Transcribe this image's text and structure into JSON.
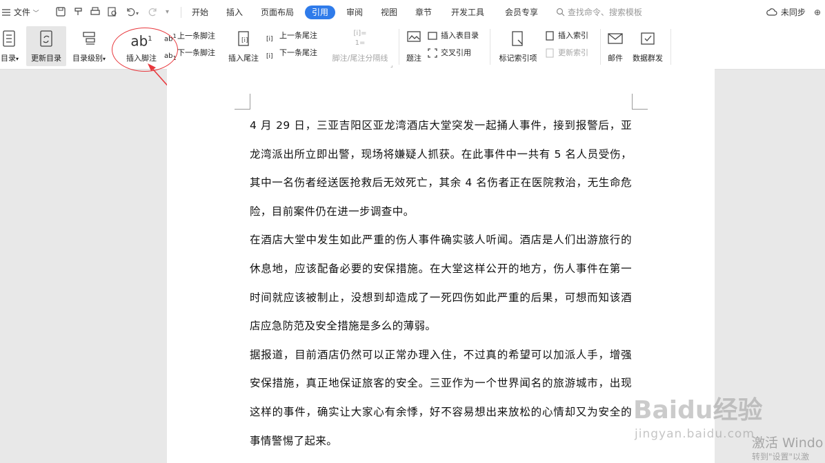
{
  "topbar": {
    "menu_label": "文件",
    "tabs": [
      {
        "label": "开始"
      },
      {
        "label": "插入"
      },
      {
        "label": "页面布局"
      },
      {
        "label": "引用"
      },
      {
        "label": "审阅"
      },
      {
        "label": "视图"
      },
      {
        "label": "章节"
      },
      {
        "label": "开发工具"
      },
      {
        "label": "会员专享"
      }
    ],
    "active_tab": "引用",
    "search_placeholder": "查找命令、搜索模板",
    "sync_label": "未同步"
  },
  "ribbon": {
    "toc": "目录",
    "update_toc": "更新目录",
    "toc_level": "目录级别",
    "insert_footnote": "插入脚注",
    "prev_footnote": "上一条脚注",
    "next_footnote": "下一条脚注",
    "insert_endnote": "插入尾注",
    "prev_endnote": "上一条尾注",
    "next_endnote": "下一条尾注",
    "separator": "脚注/尾注分隔线",
    "caption": "题注",
    "insert_figure_toc": "插入表目录",
    "cross_ref": "交叉引用",
    "mark_index": "标记索引项",
    "insert_index": "插入索引",
    "update_index": "更新索引",
    "mail": "邮件",
    "mail_merge": "数据群发"
  },
  "document": {
    "paragraphs": [
      "4 月 29 日，三亚吉阳区亚龙湾酒店大堂突发一起捅人事件，接到报警后，亚龙湾派出所立即出警，现场将嫌疑人抓获。在此事件中一共有 5 名人员受伤，其中一名伤者经送医抢救后无效死亡，其余 4 名伤者正在医院救治，无生命危险，目前案件仍在进一步调查中。",
      "在酒店大堂中发生如此严重的伤人事件确实骇人听闻。酒店是人们出游旅行的休息地，应该配备必要的安保措施。在大堂这样公开的地方，伤人事件在第一时间就应该被制止，没想到却造成了一死四伤如此严重的后果，可想而知该酒店应急防范及安全措施是多么的薄弱。",
      "据报道，目前酒店仍然可以正常办理入住，不过真的希望可以加派人手，增强安保措施，真正地保证旅客的安全。三亚作为一个世界闻名的旅游城市，出现这样的事件，确实让大家心有余悸，好不容易想出来放松的心情却又为安全的事情警惕了起来。"
    ]
  },
  "watermarks": {
    "brand": "Baidu经验",
    "url": "jingyan.baidu.com",
    "activate_title": "激活 Windo",
    "activate_sub": "转到\"设置\"以激"
  },
  "colors": {
    "accent": "#2f7bea",
    "annotation": "#e8383d"
  }
}
